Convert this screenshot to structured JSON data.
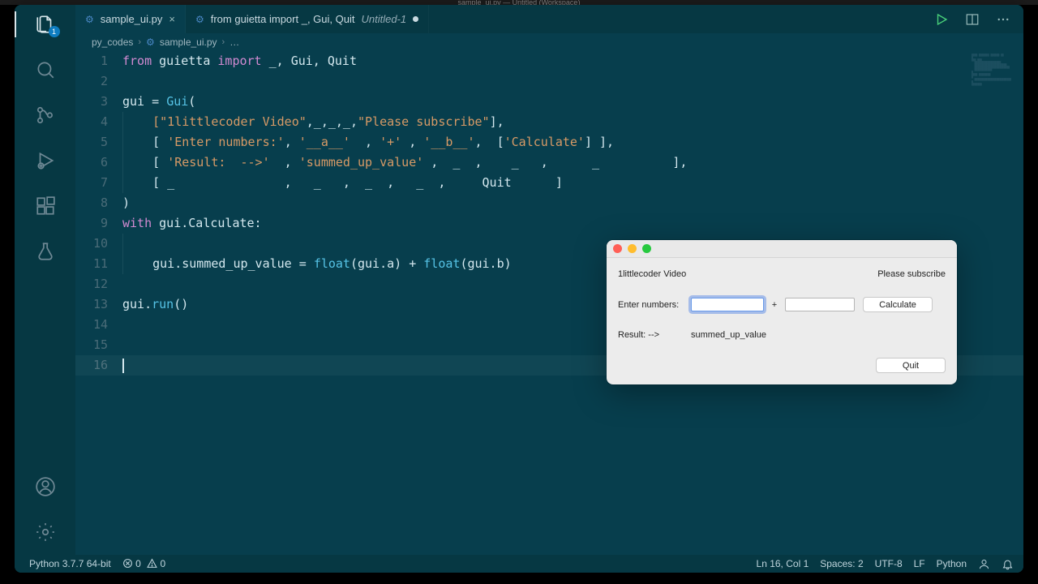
{
  "titlebar": "sample_ui.py — Untitled (Workspace)",
  "activity_bar": {
    "badge": "1"
  },
  "tabs": {
    "active": {
      "icon_name": "python",
      "label": "sample_ui.py"
    },
    "second": {
      "icon_name": "python",
      "prefix": "from guietta import _, Gui, Quit",
      "suffix": "Untitled-1"
    }
  },
  "breadcrumbs": {
    "root": "py_codes",
    "file": "sample_ui.py",
    "trail": "…"
  },
  "code": {
    "line_numbers": [
      "1",
      "2",
      "3",
      "4",
      "5",
      "6",
      "7",
      "8",
      "9",
      "10",
      "11",
      "12",
      "13",
      "14",
      "15",
      "16"
    ],
    "l1": {
      "kw_from": "from",
      "mod": "guietta",
      "kw_import": "import",
      "names": "_, Gui, Quit"
    },
    "l3_lhs": "gui = ",
    "l3_fn": "Gui",
    "l3_open": "(",
    "l4": "    [\"1littlecoder Video\",_,_,_,\"Please subscribe\"],",
    "l5": "    [ 'Enter numbers:', '__a__'  , '+' , '__b__',  ['Calculate'] ],",
    "l6": "    [ 'Result:  -->'  , 'summed_up_value' ,  _  ,    _   ,      _          ],",
    "l7": "    [ _               ,   _   ,  _  ,   _  ,     Quit      ]",
    "l8": ")",
    "l9_kw": "with",
    "l9_rest": " gui.Calculate:",
    "l11a": "    gui.summed_up_value = ",
    "l11_fn1": "float",
    "l11b": "(gui.a) + ",
    "l11_fn2": "float",
    "l11c": "(gui.b)",
    "l13a": "gui.",
    "l13_fn": "run",
    "l13b": "()"
  },
  "dialog": {
    "title_left": "1littlecoder Video",
    "title_right": "Please subscribe",
    "enter_label": "Enter numbers:",
    "plus": "+",
    "calculate": "Calculate",
    "result_label": "Result:  -->",
    "result_value": "summed_up_value",
    "quit": "Quit"
  },
  "statusbar": {
    "interpreter": "Python 3.7.7 64-bit",
    "problems_err": "0",
    "problems_warn": "0",
    "pos": "Ln 16, Col 1",
    "spaces": "Spaces: 2",
    "encoding": "UTF-8",
    "eol": "LF",
    "lang": "Python"
  }
}
